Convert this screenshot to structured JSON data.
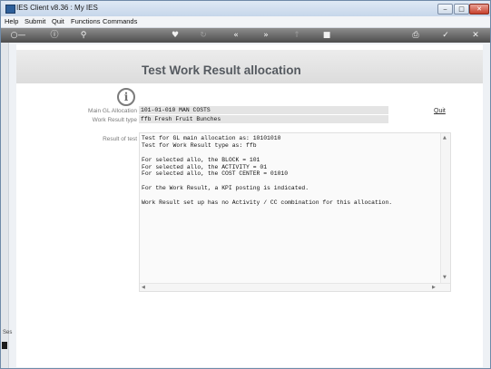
{
  "window": {
    "title": "IES Client v8.36 : My IES"
  },
  "menu": {
    "items": [
      "Help",
      "Submit",
      "Quit",
      "Functions",
      "Commands"
    ]
  },
  "toolbar": {
    "icons": [
      "back-key-icon",
      "help-icon",
      "search-icon",
      "heart-icon",
      "refresh-icon",
      "rewind-icon",
      "forward-icon",
      "upload-icon",
      "stop-icon",
      "print-icon",
      "check-icon",
      "close-icon"
    ]
  },
  "page": {
    "title": "Test Work Result allocation"
  },
  "fields": {
    "main_gl_label": "Main GL Allocation",
    "main_gl_value": "101-01-010 MAN COSTS",
    "work_result_type_label": "Work Result type",
    "work_result_type_value": "ffb Fresh Fruit Bunches"
  },
  "actions": {
    "quit": "Quit"
  },
  "result": {
    "label": "Result of test",
    "lines": [
      "Test for GL main allocation as: 10101010",
      "Test for Work Result type as: ffb",
      "",
      "For selected allo, the BLOCK = 101",
      "For selected allo, the ACTIVITY = 01",
      "For selected allo, the COST CENTER = 01010",
      "",
      "For the Work Result, a KPI posting is indicated.",
      "",
      "Work Result set up has no Activity / CC combination for this allocation."
    ]
  },
  "side_panel": {
    "label": "Ses"
  }
}
